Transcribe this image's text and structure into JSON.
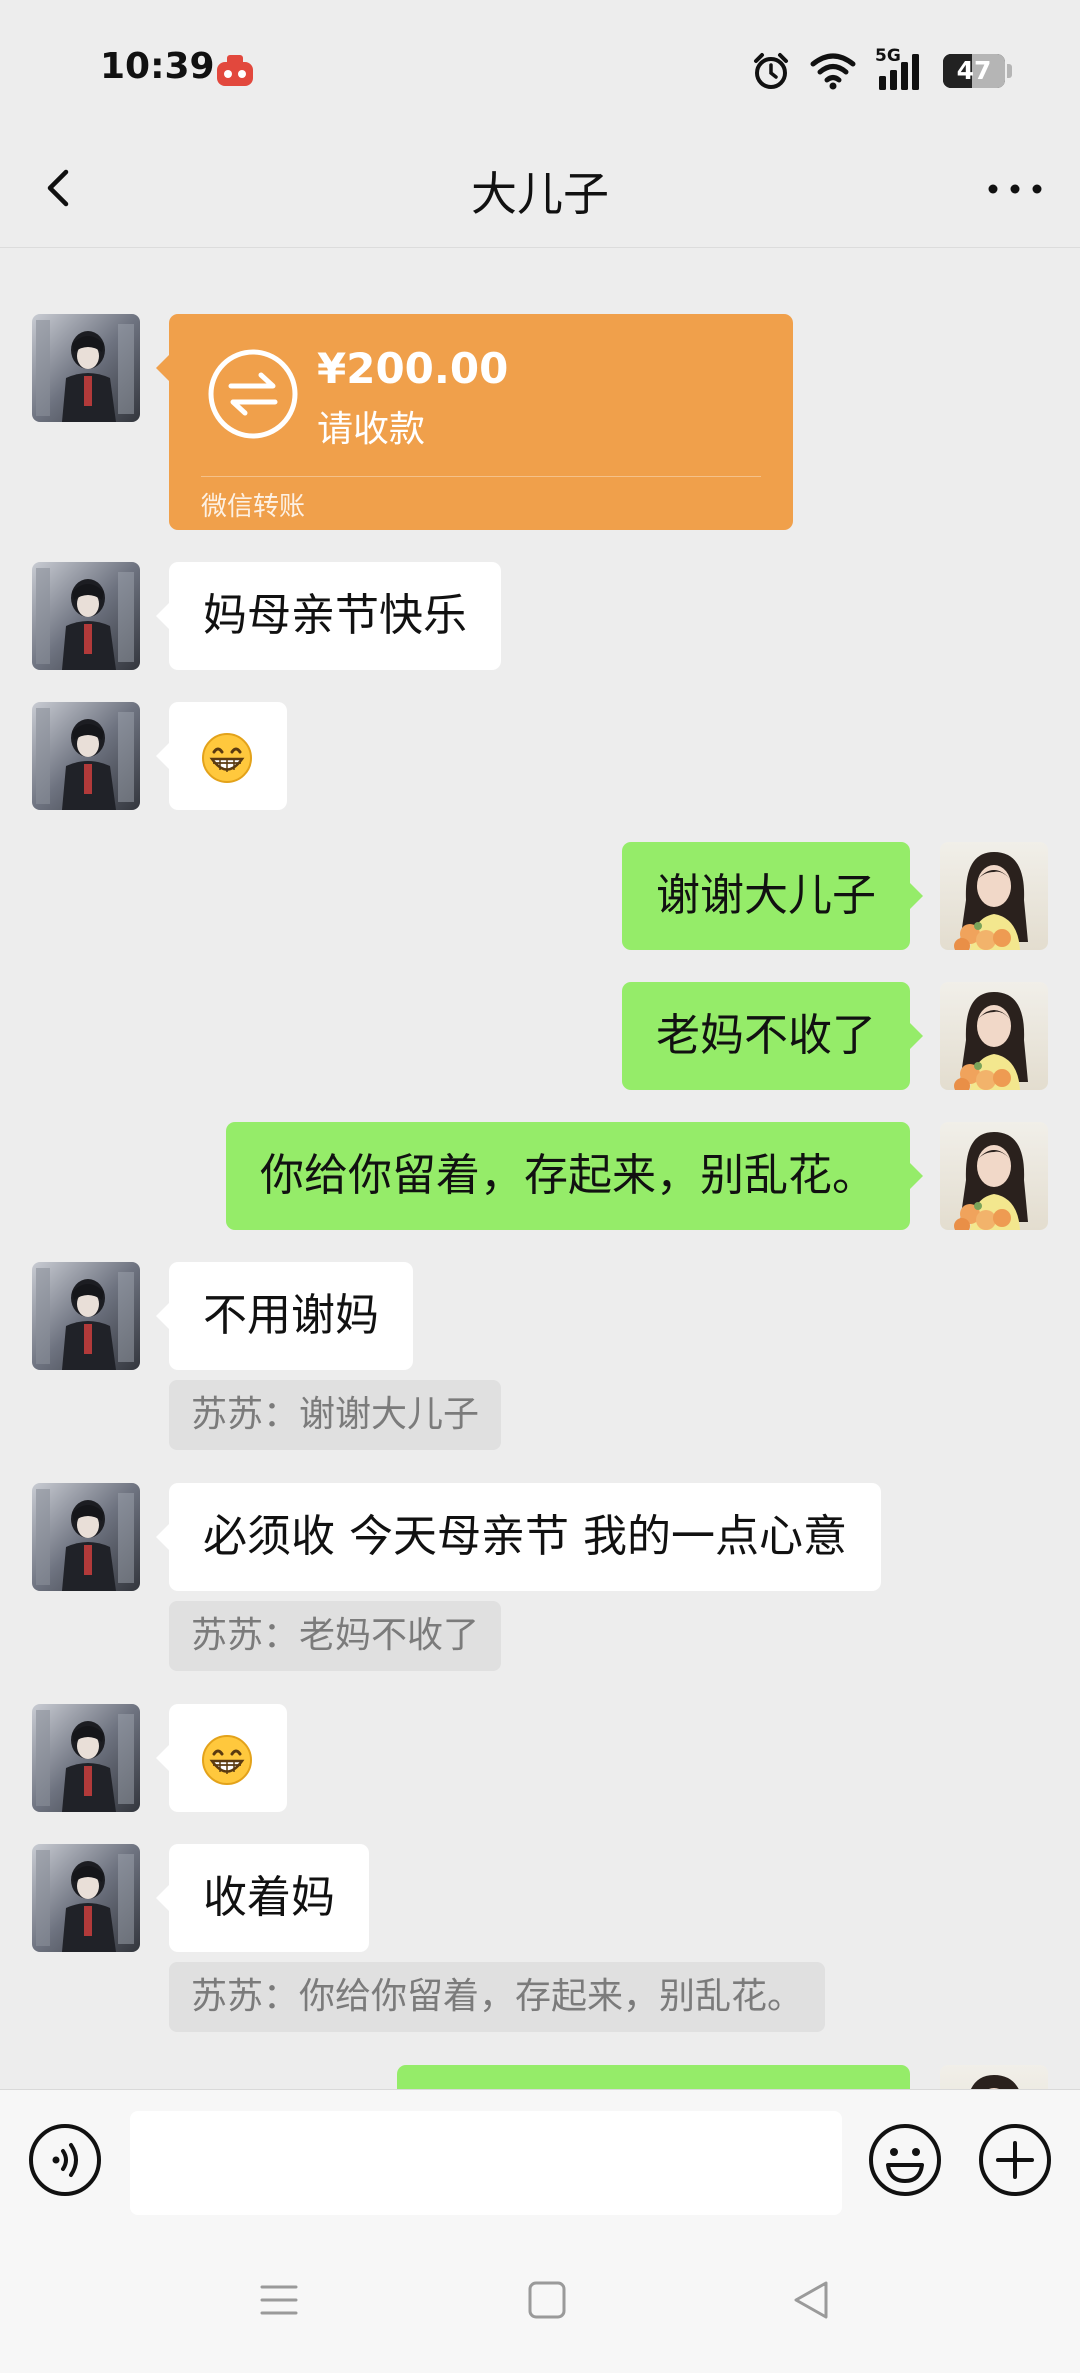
{
  "status_bar": {
    "time": "10:39",
    "network": "5G",
    "battery": "47",
    "battery_level": 0.47
  },
  "header": {
    "title": "大儿子",
    "back_icon": "chevron-left-icon",
    "more_icon": "more-dots-icon"
  },
  "transfer": {
    "amount": "¥200.00",
    "status": "请收款",
    "source": "微信转账"
  },
  "messages": [
    {
      "side": "in",
      "text": "妈母亲节快乐"
    },
    {
      "side": "in",
      "emoji": "grin-emoji"
    },
    {
      "side": "out",
      "text": "谢谢大儿子"
    },
    {
      "side": "out",
      "text": "老妈不收了"
    },
    {
      "side": "out",
      "text": "你给你留着，存起来，别乱花。"
    },
    {
      "side": "in",
      "text": "不用谢妈",
      "quote": "苏苏：谢谢大儿子"
    },
    {
      "side": "in",
      "text": "必须收 今天母亲节 我的一点心意",
      "quote": "苏苏：老妈不收了"
    },
    {
      "side": "in",
      "emoji": "grin-emoji"
    },
    {
      "side": "in",
      "text": "收着妈",
      "quote": "苏苏：你给你留着，存起来，别乱花。"
    }
  ],
  "input_bar": {
    "value": "",
    "voice_icon": "voice-icon",
    "emoji_icon": "emoji-icon",
    "plus_icon": "plus-icon"
  },
  "colors": {
    "background": "#ededed",
    "outgoing_bubble": "#95ec69",
    "incoming_bubble": "#ffffff",
    "transfer": "#f0a04b",
    "quote": "#e0e0e0"
  }
}
